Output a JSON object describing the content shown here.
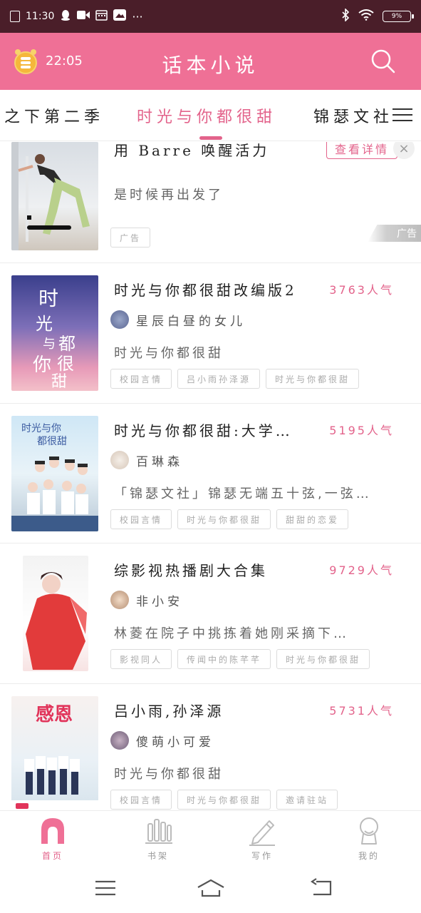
{
  "status_bar": {
    "time": "11:30",
    "battery": "9%",
    "icons": [
      "notification-x-icon",
      "qq-icon",
      "video-icon",
      "calendar-icon",
      "gallery-icon",
      "more-icon",
      "bluetooth-icon",
      "wifi-icon",
      "battery-icon"
    ],
    "more": "···"
  },
  "header": {
    "time": "22:05",
    "title": "话本小说",
    "accent": "#ef7096"
  },
  "tabs": {
    "items": [
      {
        "label": "之下第二季",
        "active": false
      },
      {
        "label": "时光与你都很甜",
        "active": true
      },
      {
        "label": "锦瑟文社",
        "active": false
      }
    ]
  },
  "ad": {
    "title": "用 Barre 唤醒活力",
    "button": "查看详情",
    "close": "×",
    "desc": "是时候再出发了",
    "tag": "广告",
    "corner": "广告"
  },
  "books": [
    {
      "title": "时光与你都很甜改编版2",
      "popularity": "3763人气",
      "author": "星辰白昼的女儿",
      "desc": "时光与你都很甜",
      "tags": [
        "校园言情",
        "吕小雨孙泽源",
        "时光与你都很甜"
      ],
      "cover_text": [
        "时",
        "光",
        "与",
        "都",
        "你",
        "很",
        "甜"
      ]
    },
    {
      "title": "时光与你都很甜:大学…",
      "popularity": "5195人气",
      "author": "百琳森",
      "desc": "「锦瑟文社」锦瑟无端五十弦,一弦…",
      "tags": [
        "校园言情",
        "时光与你都很甜",
        "甜甜的恋爱"
      ],
      "cover_text": [
        "时光与你",
        "都很甜"
      ]
    },
    {
      "title": "综影视热播剧大合集",
      "popularity": "9729人气",
      "author": "非小安",
      "desc": "林菱在院子中挑拣着她刚采摘下…",
      "tags": [
        "影视同人",
        "传闻中的陈芊芊",
        "时光与你都很甜"
      ],
      "cover_text": []
    },
    {
      "title": "吕小雨,孙泽源",
      "popularity": "5731人气",
      "author": "傻萌小可爱",
      "desc": "时光与你都很甜",
      "tags": [
        "校园言情",
        "时光与你都很甜",
        "邀请驻站"
      ],
      "cover_text": [
        "感恩"
      ]
    }
  ],
  "bottom_nav": [
    {
      "label": "首页",
      "icon": "home-icon",
      "active": true
    },
    {
      "label": "书架",
      "icon": "bookshelf-icon",
      "active": false
    },
    {
      "label": "写作",
      "icon": "pen-icon",
      "active": false
    },
    {
      "label": "我的",
      "icon": "profile-icon",
      "active": false
    }
  ]
}
